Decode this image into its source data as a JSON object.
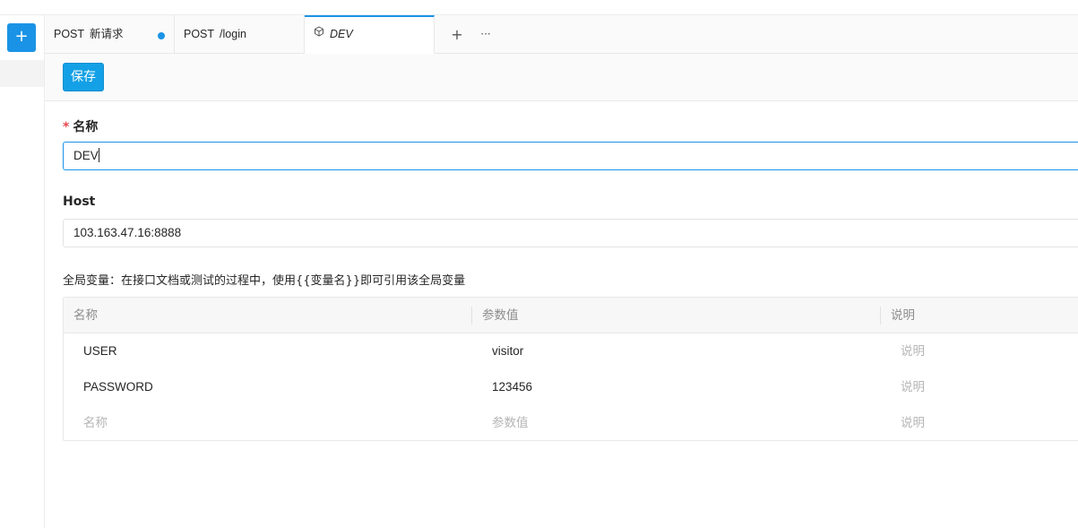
{
  "sidebar": {
    "new_button_label": "+"
  },
  "tabs": [
    {
      "method": "POST",
      "title": "新请求",
      "unsaved": true
    },
    {
      "method": "POST",
      "title": "/login",
      "unsaved": false
    },
    {
      "method": "",
      "title": "DEV",
      "active": true
    }
  ],
  "tab_actions": {
    "add": "+",
    "more": "···"
  },
  "toolbar": {
    "save_label": "保存"
  },
  "form": {
    "name_required": "*",
    "name_label": "名称",
    "name_value": "DEV",
    "host_label": "Host",
    "host_value": "103.163.47.16:8888",
    "global_vars_desc": "全局变量：在接口文档或测试的过程中，使用{{变量名}}即可引用该全局变量"
  },
  "vars_table": {
    "columns": [
      "名称",
      "参数值",
      "说明"
    ],
    "rows": [
      {
        "name": "USER",
        "value": "visitor",
        "note": "说明"
      },
      {
        "name": "PASSWORD",
        "value": "123456",
        "note": "说明"
      }
    ],
    "new_row_placeholders": {
      "name": "名称",
      "value": "参数值",
      "note": "说明"
    }
  },
  "colors": {
    "accent": "#1a93e6",
    "required": "#e5484d"
  }
}
